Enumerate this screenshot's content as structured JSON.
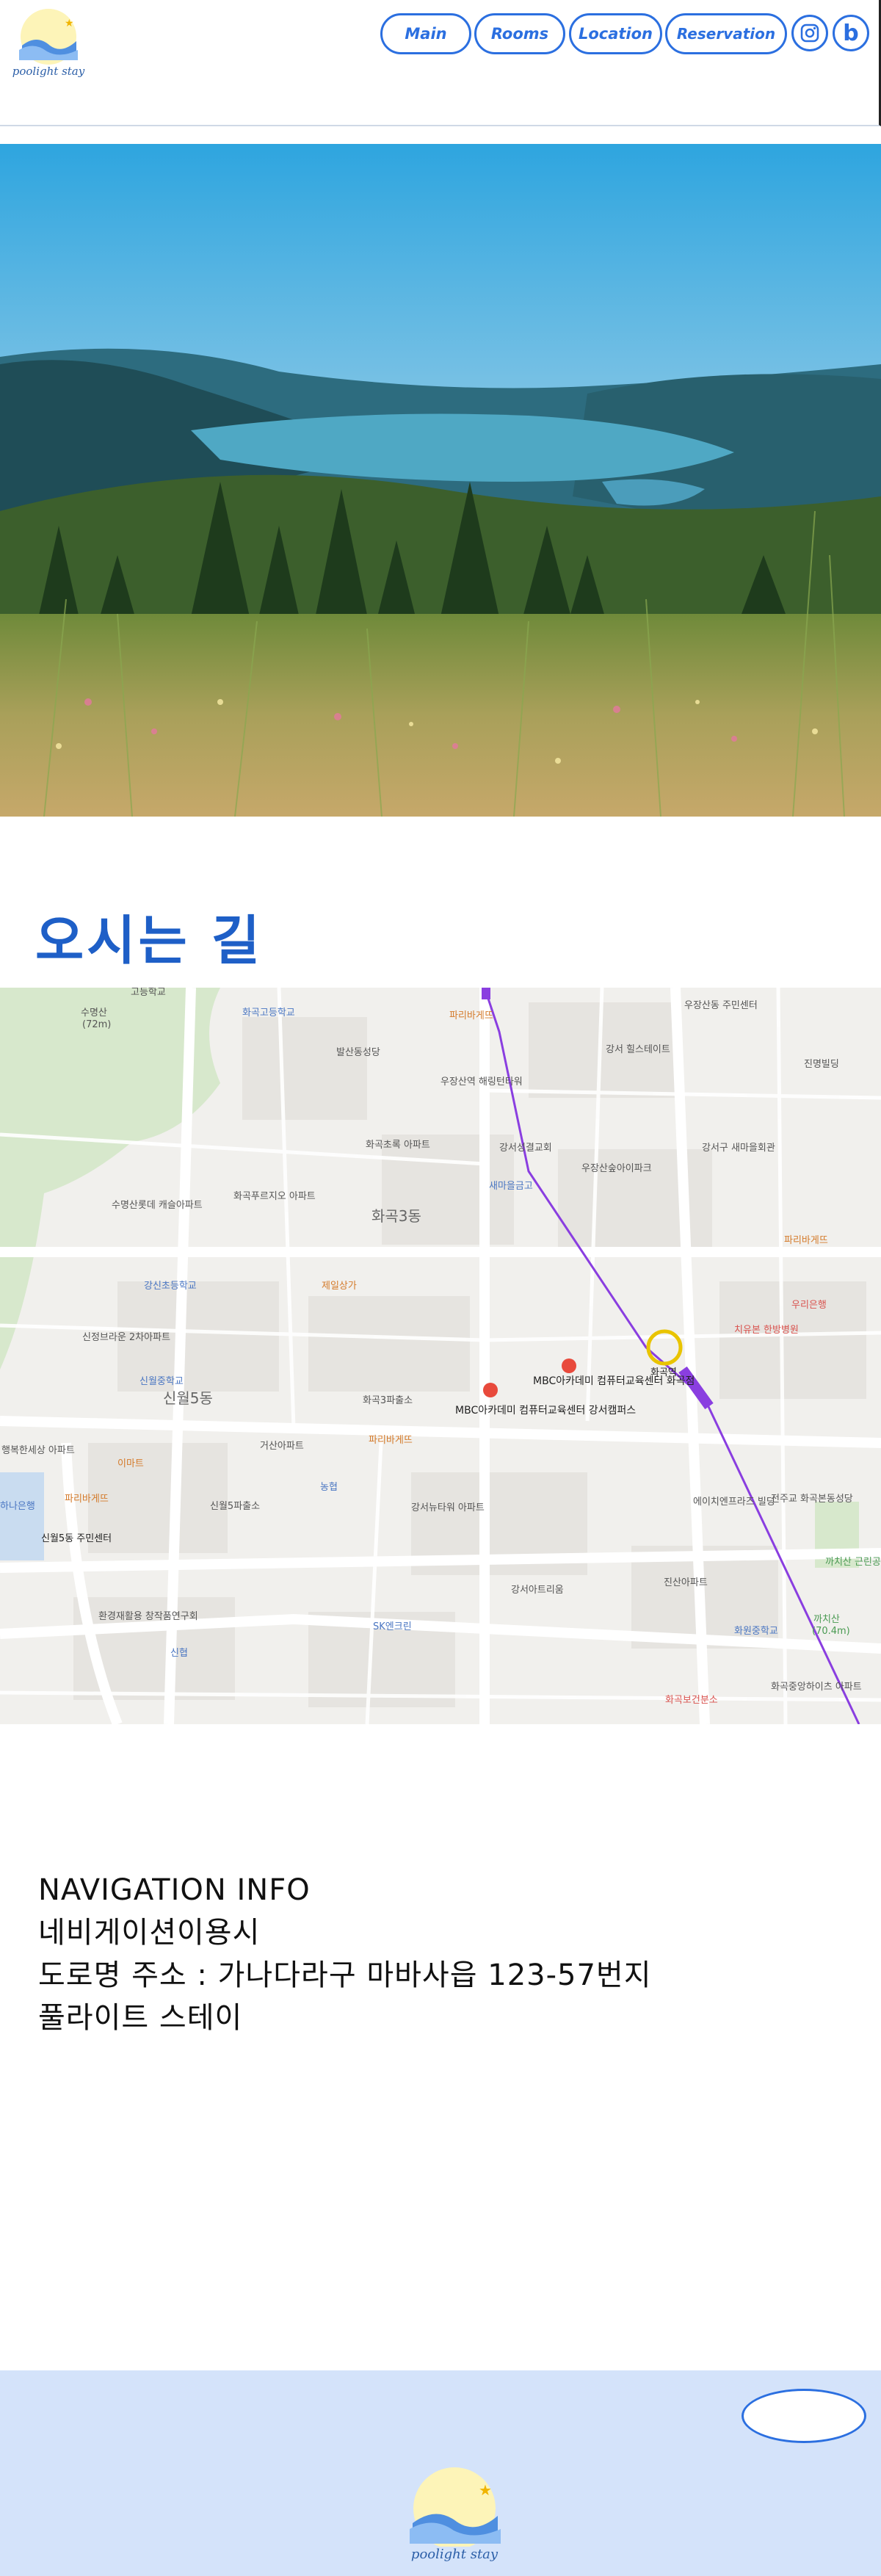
{
  "brand": {
    "logo_text": "poolight stay"
  },
  "nav": {
    "main": "Main",
    "rooms": "Rooms",
    "location": "Location",
    "reservation": "Reservation",
    "instagram_icon": "instagram-icon",
    "blog_icon": "blog-icon",
    "blog_letter": "b"
  },
  "section": {
    "title": "오시는 길"
  },
  "map": {
    "labels": {
      "suyeongsan": "수명산",
      "suyeongsan_alt": "(72m)",
      "gojeong": "고등학교",
      "hwagok_high": "화곡고등학교",
      "balsan": "발산동성당",
      "paris1": "파리바게뜨",
      "woojang_center": "우장산동 주민센터",
      "hills": "강서 힐스테이트",
      "jinmyeong": "진명빌딩",
      "woojang_station": "우장산역 해링턴타워",
      "gangseo_church": "강서성결교회",
      "woojang_apt": "우장산숲아이파크",
      "gangseo_hall": "강서구 새마을회관",
      "hwagok_chorok": "화곡초록 아파트",
      "saemaeul": "새마을금고",
      "suyeong_lotte": "수명산롯데 캐슬아파트",
      "hwagok_prugio": "화곡푸르지오 아파트",
      "hwagok3": "화곡3동",
      "gangsin": "강신초등학교",
      "jeil": "제일상가",
      "paris2": "파리바게뜨",
      "sinjeong_brown": "신정브라운 2차아파트",
      "chiyu": "치유본 한방병원",
      "woori": "우리은행",
      "mbc1": "MBC아카데미 컴퓨터교육센터 화곡점",
      "mbc2": "MBC아카데미 컴퓨터교육센터 강서캠퍼스",
      "hwagok_station": "화곡역",
      "sinwol5": "신월5동",
      "sinwol_elem": "신월중학교",
      "hwagok3_police": "화곡3파출소",
      "geosan": "거산아파트",
      "paris3": "파리바게뜨",
      "haengbok": "행복한세상 아파트",
      "emart": "이마트",
      "nonghyup": "농협",
      "paris4": "파리바게뜨",
      "sinwol5_police": "신월5파출소",
      "gangseo_newtown": "강서뉴타워 아파트",
      "eijienterprise": "에이치엔프라즈 빌딩",
      "jeonju": "전주교 화곡본동성당",
      "sinwol5_center": "신월5동 주민센터",
      "hana": "하나은행",
      "kachisan_park": "까치산 근린공원",
      "jinsan": "진산아파트",
      "gangseo_apt": "강서아트리움",
      "hwanggyeong": "환경재활용 창작품연구회",
      "sk": "SK엔크린",
      "hwawon": "화원중학교",
      "kachisan": "까치산",
      "kachisan_alt": "(70.4m)",
      "sinhyeop": "신협",
      "hwagok_health": "화곡보건분소",
      "hwagok_jungang": "화곡중앙하이츠 아파트"
    }
  },
  "info": {
    "line1": "NAVIGATION INFO",
    "line2": "네비게이션이용시",
    "line3": "도로명 주소 : 가나다라구 마바사읍 123-57번지",
    "line4": "풀라이트 스테이"
  },
  "footer": {
    "logo_text": "poolight stay"
  }
}
